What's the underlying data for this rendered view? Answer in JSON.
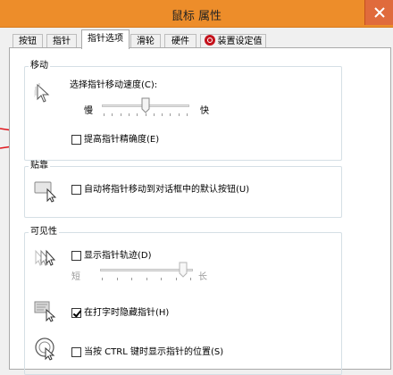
{
  "window": {
    "title": "鼠标 属性"
  },
  "tabs": [
    {
      "label": "按钮",
      "active": false
    },
    {
      "label": "指针",
      "active": false
    },
    {
      "label": "指针选项",
      "active": true
    },
    {
      "label": "滑轮",
      "active": false
    },
    {
      "label": "硬件",
      "active": false
    },
    {
      "label": "装置设定值",
      "active": false,
      "icon": "lead-logo-icon"
    }
  ],
  "motion": {
    "group_label": "移动",
    "speed_label": "选择指针移动速度(C):",
    "slow_label": "慢",
    "fast_label": "快",
    "speed_value": 0.5,
    "precision_label": "提高指针精确度(E)",
    "precision_checked": false
  },
  "snap": {
    "group_label": "贴靠",
    "snap_label": "自动将指针移动到对话框中的默认按钮(U)",
    "snap_checked": false
  },
  "visibility": {
    "group_label": "可见性",
    "trails_label": "显示指针轨迹(D)",
    "trails_checked": false,
    "short_label": "短",
    "long_label": "长",
    "trails_value": 0.92,
    "hide_label": "在打字时隐藏指针(H)",
    "hide_checked": true,
    "ctrl_label": "当按 CTRL 键时显示指针的位置(S)",
    "ctrl_checked": false
  },
  "colors": {
    "titlebar": "#ed8d2a",
    "annotation_arrow": "#e0141a",
    "lead_logo": "#c4121c"
  }
}
